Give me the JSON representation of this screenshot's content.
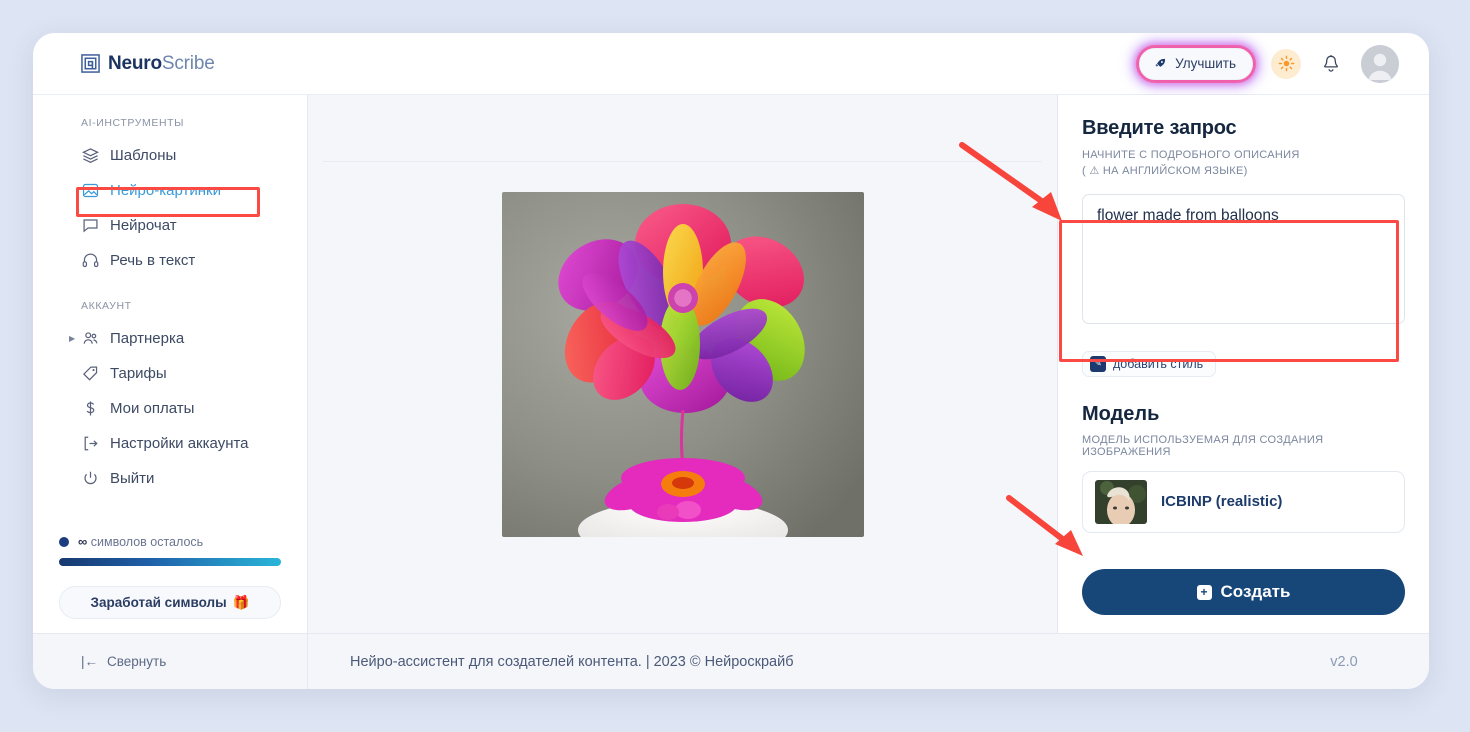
{
  "header": {
    "logo_bold": "Neuro",
    "logo_light": "Scribe",
    "logo_icon": "nested-square-logo-icon",
    "improve_label": "Улучшить",
    "improve_icon": "rocket-icon",
    "theme_icon": "sun-icon",
    "notifications_icon": "bell-icon",
    "avatar_icon": "user-avatar-icon"
  },
  "sidebar": {
    "section_tools_label": "AI-ИНСТРУМЕНТЫ",
    "section_account_label": "АККАУНТ",
    "tools": [
      {
        "label": "Шаблоны",
        "icon": "layers-icon",
        "active": false
      },
      {
        "label": "Нейро-картинки",
        "icon": "image-icon",
        "active": true
      },
      {
        "label": "Нейрочат",
        "icon": "chat-bubble-icon",
        "active": false
      },
      {
        "label": "Речь в текст",
        "icon": "headphones-icon",
        "active": false
      }
    ],
    "account": [
      {
        "label": "Партнерка",
        "icon": "users-icon",
        "expandable": true
      },
      {
        "label": "Тарифы",
        "icon": "tag-icon",
        "expandable": false
      },
      {
        "label": "Мои оплаты",
        "icon": "dollar-icon",
        "expandable": false
      },
      {
        "label": "Настройки аккаунта",
        "icon": "account-settings-icon",
        "expandable": false
      },
      {
        "label": "Выйти",
        "icon": "power-icon",
        "expandable": false
      }
    ],
    "meter": {
      "count": "∞",
      "label": "символов осталось",
      "progress_percent": 100
    },
    "earn_label": "Заработай символы",
    "earn_icon": "gift-icon"
  },
  "main": {
    "image_alt": "flower made from balloons generated image"
  },
  "right_panel": {
    "prompt_title": "Введите запрос",
    "prompt_subtitle_line1": "НАЧНИТЕ С ПОДРОБНОГО ОПИСАНИЯ",
    "prompt_subtitle_line2": "( ⚠ НА АНГЛИЙСКОМ ЯЗЫКЕ)",
    "prompt_value": "flower made from balloons",
    "prompt_placeholder": "",
    "style_button_label": "добавить стиль",
    "style_button_icon": "pencil-square-icon",
    "model_title": "Модель",
    "model_subtitle": "МОДЕЛЬ ИСПОЛЬЗУЕМАЯ ДЛЯ СОЗДАНИЯ ИЗОБРАЖЕНИЯ",
    "model_selected": "ICBINP (realistic)",
    "create_label": "Создать",
    "create_icon": "plus-square-icon"
  },
  "footer": {
    "collapse_label": "Свернуть",
    "collapse_icon": "collapse-left-icon",
    "copyright": "Нейро-ассистент для создателей контента.  | 2023 © Нейроскрайб",
    "version": "v2.0"
  },
  "annotations": {
    "highlight_color": "#fb4a43",
    "arrow_color": "#f8453c",
    "boxes": [
      "sidebar-item-neuro-images",
      "prompt-textarea"
    ],
    "arrows": [
      "arrow-to-prompt",
      "arrow-to-create-button"
    ]
  }
}
